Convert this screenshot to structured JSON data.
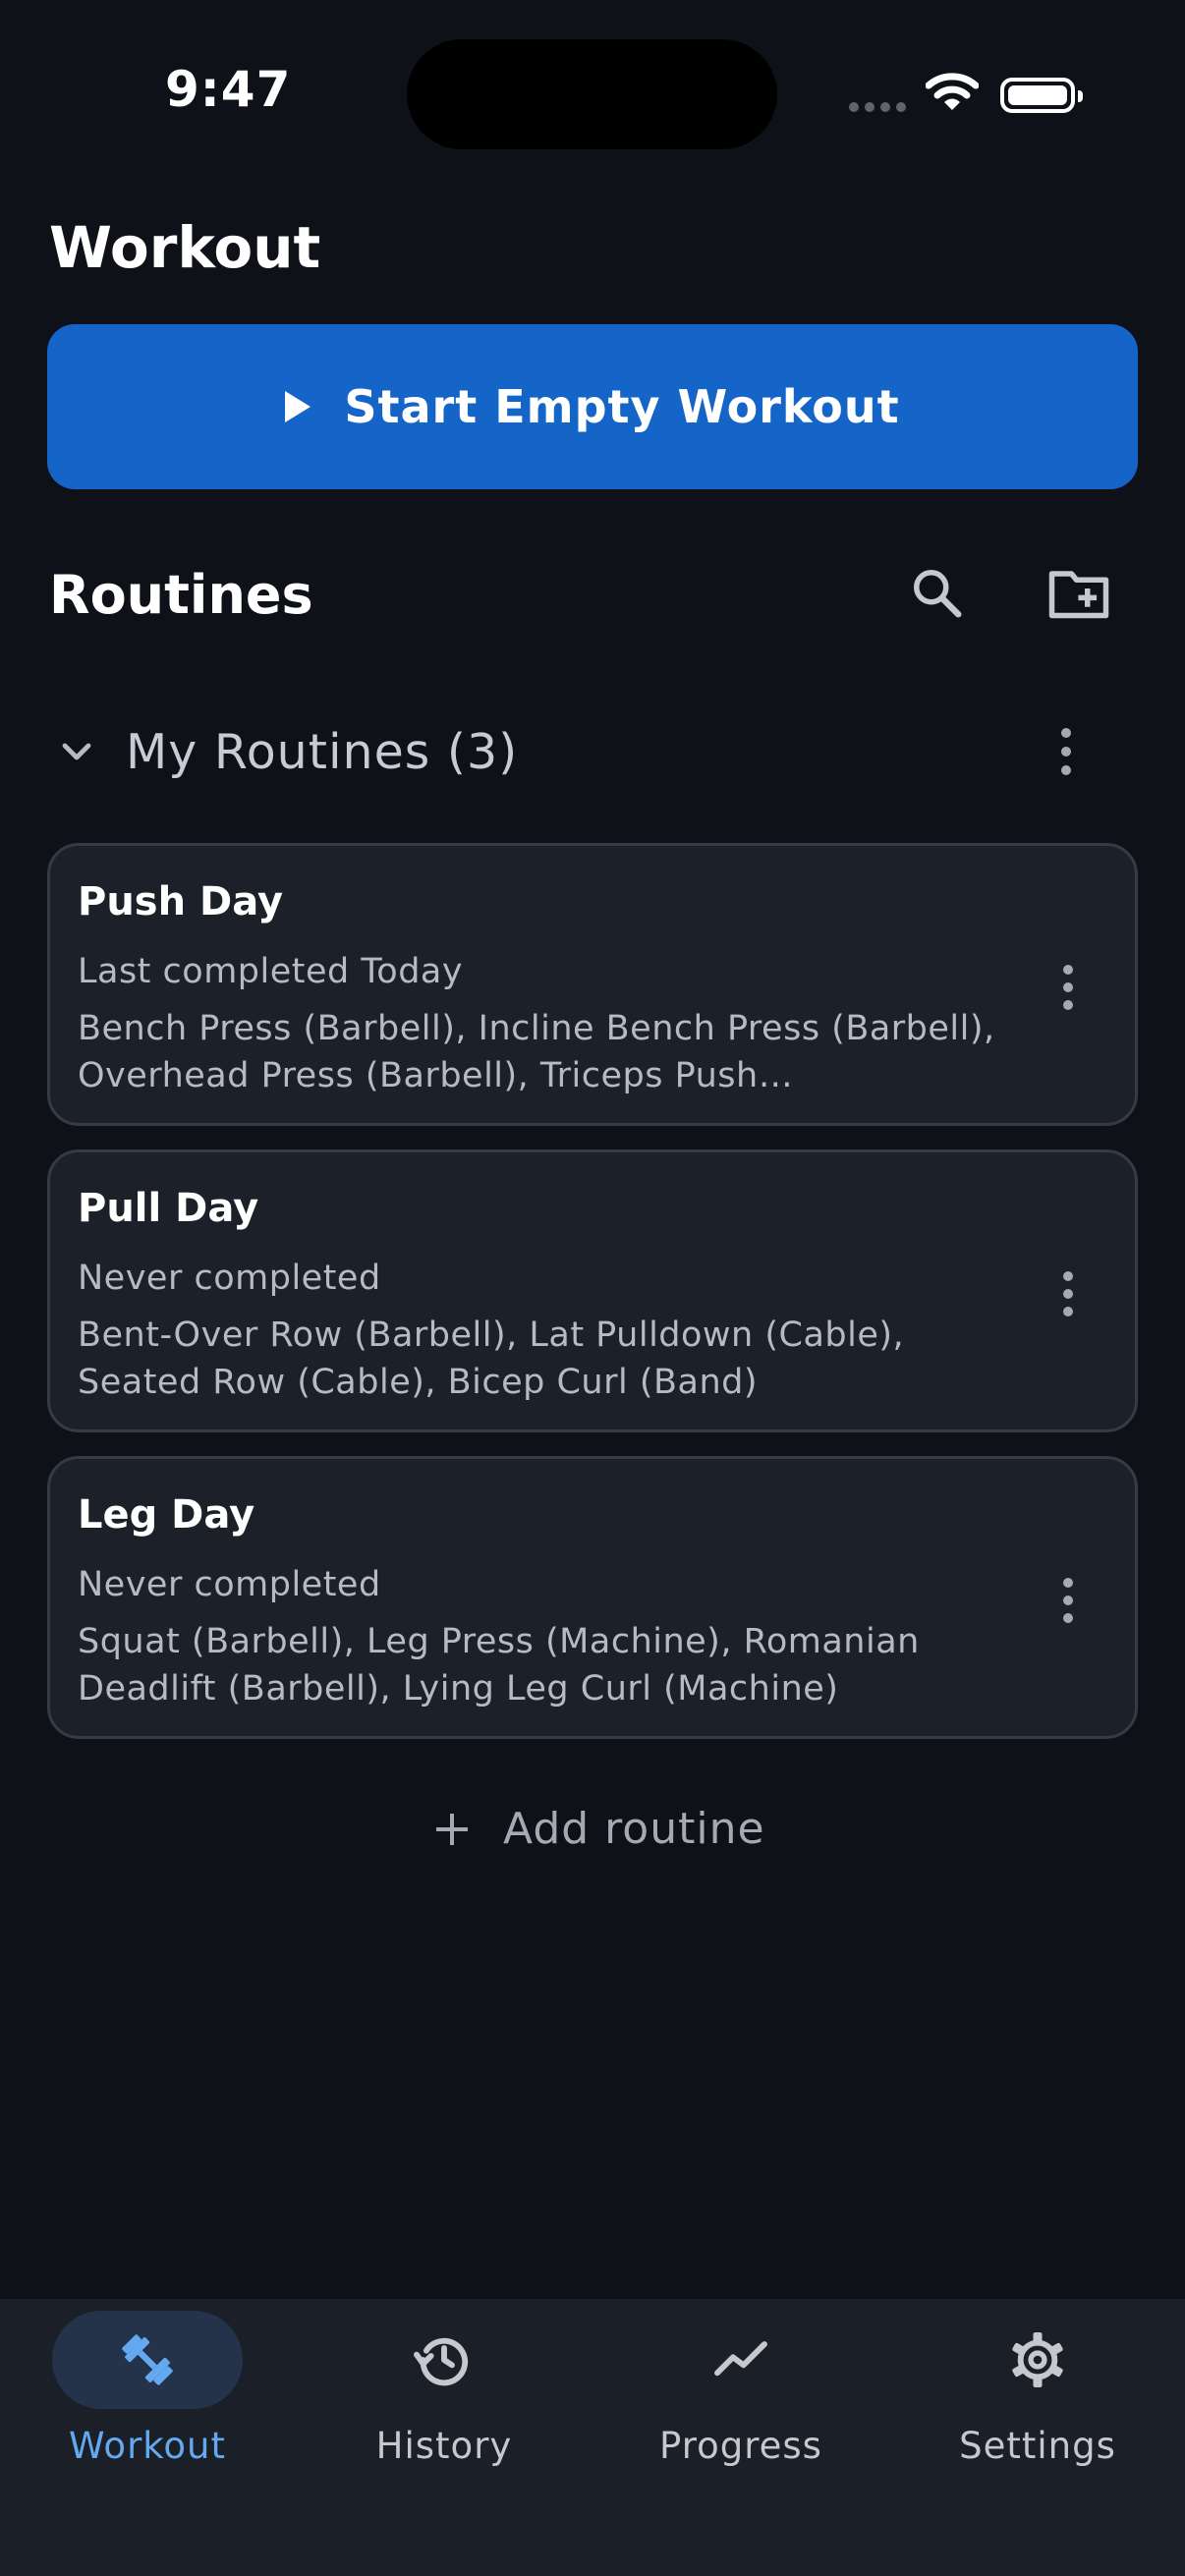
{
  "status_bar": {
    "time": "9:47"
  },
  "header": {
    "title": "Workout"
  },
  "start_button": {
    "label": "Start Empty Workout",
    "icon": "play-icon"
  },
  "routines_section": {
    "title": "Routines",
    "icons": [
      "search-icon",
      "new-folder-icon"
    ]
  },
  "folder": {
    "label": "My Routines (3)",
    "expanded": true,
    "icons": [
      "chevron-down-icon",
      "more-vert-icon"
    ]
  },
  "routines": [
    {
      "title": "Push Day",
      "status": "Last completed Today",
      "exercises": "Bench Press (Barbell), Incline Bench Press (Barbell), Overhead Press (Barbell), Triceps Push…"
    },
    {
      "title": "Pull Day",
      "status": "Never completed",
      "exercises": "Bent-Over Row (Barbell), Lat Pulldown (Cable), Seated Row (Cable), Bicep Curl (Band)"
    },
    {
      "title": "Leg Day",
      "status": "Never completed",
      "exercises": "Squat (Barbell), Leg Press (Machine), Romanian Deadlift (Barbell), Lying Leg Curl (Machine)"
    }
  ],
  "add_routine": {
    "label": "Add routine",
    "icon": "plus-icon"
  },
  "bottom_nav": {
    "items": [
      {
        "label": "Workout",
        "icon": "dumbbell-icon",
        "active": true
      },
      {
        "label": "History",
        "icon": "history-icon",
        "active": false
      },
      {
        "label": "Progress",
        "icon": "trending-icon",
        "active": false
      },
      {
        "label": "Settings",
        "icon": "gear-icon",
        "active": false
      }
    ]
  },
  "colors": {
    "background": "#0e1118",
    "primary_button": "#1565c8",
    "card": "#1c2029",
    "nav_active": "#64a9ef",
    "nav_pill": "#243349"
  }
}
